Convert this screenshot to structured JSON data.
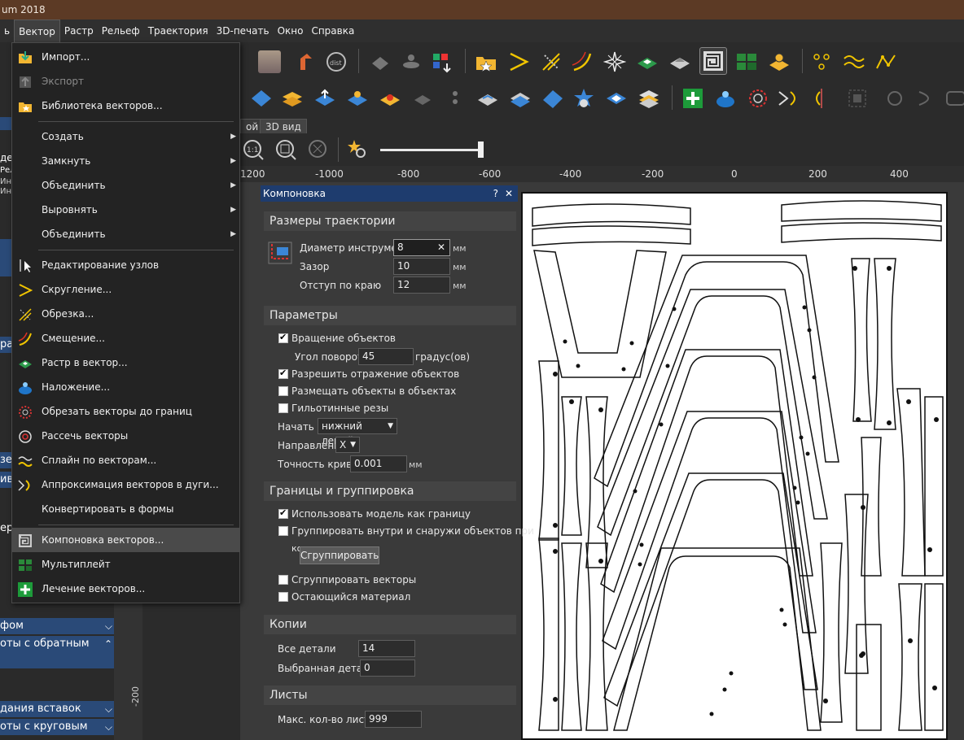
{
  "window": {
    "title": "um 2018"
  },
  "menubar": {
    "items": [
      "ь",
      "Вектор",
      "Растр",
      "Рельеф",
      "Траектория",
      "3D-печать",
      "Окно",
      "Справка"
    ],
    "active_index": 1
  },
  "tabs": {
    "tab1": "ой",
    "tab2": "3D вид"
  },
  "ruler": {
    "labels": [
      "1200",
      "-1000",
      "-800",
      "-600",
      "-400",
      "-200",
      "0",
      "200",
      "400"
    ]
  },
  "vruler": {
    "label": "-200"
  },
  "left_panel": {
    "frag_de": "де",
    "frag_rel": "Рел",
    "frag_ink": "Инк",
    "frag_inv": "Инв",
    "frag_ras": "рас",
    "frag_zek": "зек",
    "frag_iv": "ив",
    "frag_er": "ер,",
    "item1": "фом",
    "item2": "оты с обратным",
    "item3": "дания вставок",
    "item4": "оты с круговым"
  },
  "vector_menu": {
    "items": [
      {
        "label": "Импорт...",
        "icon": "import-icon"
      },
      {
        "label": "Экспорт",
        "icon": "export-icon",
        "disabled": true
      },
      {
        "label": "Библиотека векторов...",
        "icon": "vector-library-icon"
      },
      {
        "label": "Создать",
        "submenu": true
      },
      {
        "label": "Замкнуть",
        "submenu": true
      },
      {
        "label": "Объединить",
        "submenu": true
      },
      {
        "label": "Выровнять",
        "submenu": true
      },
      {
        "label": "Объединить",
        "submenu": true
      },
      {
        "label": "Редактирование узлов",
        "icon": "node-edit-icon"
      },
      {
        "label": "Скругление...",
        "icon": "fillet-icon"
      },
      {
        "label": "Обрезка...",
        "icon": "trim-icon"
      },
      {
        "label": "Смещение...",
        "icon": "offset-icon"
      },
      {
        "label": "Растр в вектор...",
        "icon": "bitmap-to-vector-icon"
      },
      {
        "label": "Наложение...",
        "icon": "wrap-icon"
      },
      {
        "label": "Обрезать векторы до границ",
        "icon": "clip-vectors-icon"
      },
      {
        "label": "Рассечь векторы",
        "icon": "dissect-icon"
      },
      {
        "label": "Сплайн по векторам...",
        "icon": "spline-icon"
      },
      {
        "label": "Аппроксимация векторов в дуги...",
        "icon": "fit-arcs-icon"
      },
      {
        "label": "Конвертировать в формы"
      },
      {
        "label": "Компоновка векторов...",
        "icon": "nesting-icon",
        "highlighted": true
      },
      {
        "label": "Мультиплейт",
        "icon": "multiplate-icon"
      },
      {
        "label": "Лечение векторов...",
        "icon": "vector-doctor-icon"
      }
    ]
  },
  "dialog": {
    "title": "Компоновка",
    "help": "?",
    "close": "✕",
    "toolpath_section": "Размеры траектории",
    "tool_diameter_label": "Диаметр инструмента",
    "tool_diameter_value": "8",
    "tool_diameter_clear": "✕",
    "gap_label": "Зазор",
    "gap_value": "10",
    "edge_offset_label": "Отступ по краю",
    "edge_offset_value": "12",
    "unit_mm": "мм",
    "params_section": "Параметры",
    "rotate_label": "Вращение объектов",
    "rotate_checked": true,
    "rotation_angle_label": "Угол поворота",
    "rotation_angle_value": "45",
    "rotation_unit": "градус(ов)",
    "mirror_label": "Разрешить отражение объектов",
    "mirror_checked": true,
    "inside_label": "Размещать объекты в объектах",
    "inside_checked": false,
    "guillotine_label": "Гильотинные резы",
    "guillotine_checked": false,
    "start_label": "Начать с",
    "start_value": "нижний левый",
    "direction_label": "Направление",
    "direction_value": "X",
    "curve_tol_label": "Точность кривой",
    "curve_tol_value": "0.001",
    "curve_tol_unit": "мм",
    "bounds_section": "Границы и группировка",
    "use_model_label": "Использовать модель как границу",
    "use_model_checked": true,
    "group_inout_label": "Группировать внутри и снаружи объектов при",
    "group_inout_label2": "компоновке",
    "group_inout_checked": false,
    "group_button": "Сгруппировать",
    "group_vectors_label": "Сгруппировать векторы",
    "group_vectors_checked": false,
    "remaining_label": "Остающийся материал",
    "remaining_checked": false,
    "copies_section": "Копии",
    "all_parts_label": "Все детали",
    "all_parts_value": "14",
    "selected_part_label": "Выбранная деталь",
    "selected_part_value": "0",
    "sheets_section": "Листы",
    "max_sheets_label": "Макс. кол-во листов",
    "max_sheets_value": "999"
  }
}
